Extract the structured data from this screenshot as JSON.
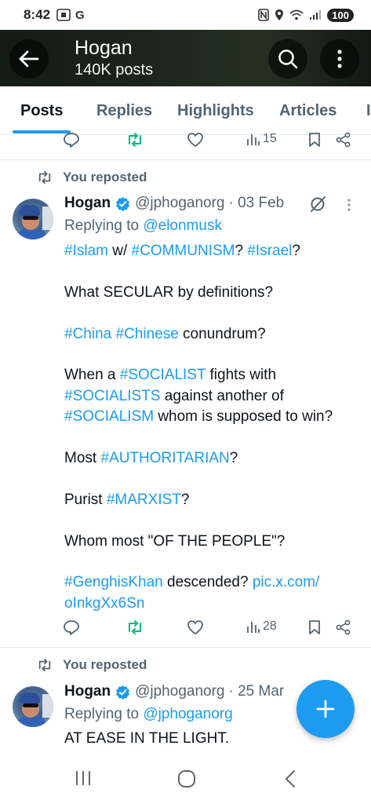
{
  "status_bar": {
    "time": "8:42",
    "left_icon_g": "G",
    "battery": "100"
  },
  "header": {
    "name": "Hogan",
    "posts_count": "140K posts"
  },
  "tabs": [
    "Posts",
    "Replies",
    "Highlights",
    "Articles"
  ],
  "active_tab": "Posts",
  "top_actions": {
    "views": "15"
  },
  "post1": {
    "repost_label": "You reposted",
    "name": "Hogan",
    "handle": "@jphoganorg",
    "date": "· 03 Feb",
    "reply_prefix": "Replying to ",
    "reply_to": "@elonmusk",
    "line1": {
      "t1": "#Islam",
      "t2": " w/ ",
      "t3": "#COMMUNISM",
      "t4": "? ",
      "t5": "#Israel",
      "t6": "?"
    },
    "line2": "What SECULAR by definitions?",
    "line3": {
      "t1": "#China",
      "t2": " ",
      "t3": "#Chinese",
      "t4": " conundrum?"
    },
    "line4": {
      "t1": "When a ",
      "t2": "#SOCIALIST",
      "t3": " fights with",
      "t4": "#SOCIALISTS",
      "t5": " against another of",
      "t6": "#SOCIALISM",
      "t7": " whom is supposed to win?"
    },
    "line5": {
      "t1": "Most ",
      "t2": "#AUTHORITARIAN",
      "t3": "?"
    },
    "line6": {
      "t1": "Purist ",
      "t2": "#MARXIST",
      "t3": "?"
    },
    "line7": "Whom most \"OF THE PEOPLE\"?",
    "line8": {
      "t1": "#GenghisKhan",
      "t2": " descended? ",
      "t3": "pic.x.com/",
      "t4": "oInkgXx6Sn"
    },
    "views": "28"
  },
  "post2": {
    "repost_label": "You reposted",
    "name": "Hogan",
    "handle": "@jphoganorg",
    "date": "· 25 Mar",
    "reply_prefix": "Replying to ",
    "reply_to": "@jphoganorg",
    "text": "AT EASE IN THE LIGHT."
  },
  "colors": {
    "accent": "#1d9bf0",
    "repost_green": "#00ba7c",
    "muted": "#536471"
  }
}
